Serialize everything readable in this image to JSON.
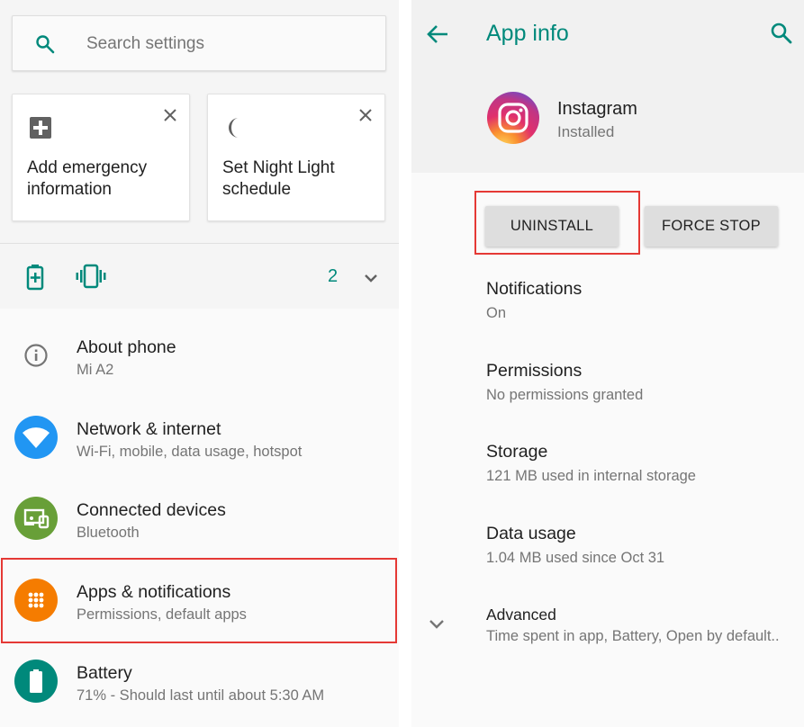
{
  "left": {
    "search": {
      "placeholder": "Search settings",
      "icon": "search-icon"
    },
    "suggestions": [
      {
        "label": "Add emergency information",
        "icon": "add-box-icon"
      },
      {
        "label": "Set Night Light schedule",
        "icon": "moon-icon"
      }
    ],
    "conditions": {
      "count": "2"
    },
    "items": [
      {
        "title": "About phone",
        "subtitle": "Mi A2",
        "icon": "info-icon",
        "color": "#757575"
      },
      {
        "title": "Network & internet",
        "subtitle": "Wi-Fi, mobile, data usage, hotspot",
        "icon": "wifi-icon",
        "color": "#2196f3"
      },
      {
        "title": "Connected devices",
        "subtitle": "Bluetooth",
        "icon": "devices-icon",
        "color": "#689f38"
      },
      {
        "title": "Apps & notifications",
        "subtitle": "Permissions, default apps",
        "icon": "apps-icon",
        "color": "#f57c00"
      },
      {
        "title": "Battery",
        "subtitle": "71% - Should last until about 5:30 AM",
        "icon": "battery-icon",
        "color": "#00897b"
      }
    ]
  },
  "right": {
    "title": "App info",
    "accent": "#00897b",
    "app": {
      "name": "Instagram",
      "status": "Installed"
    },
    "buttons": {
      "uninstall": "UNINSTALL",
      "force_stop": "FORCE STOP"
    },
    "rows": [
      {
        "title": "Notifications",
        "subtitle": "On"
      },
      {
        "title": "Permissions",
        "subtitle": "No permissions granted"
      },
      {
        "title": "Storage",
        "subtitle": "121 MB used in internal storage"
      },
      {
        "title": "Data usage",
        "subtitle": "1.04 MB used since Oct 31"
      },
      {
        "title": "Advanced",
        "subtitle": "Time spent in app, Battery, Open by default.."
      }
    ]
  },
  "highlight_color": "#e53935"
}
